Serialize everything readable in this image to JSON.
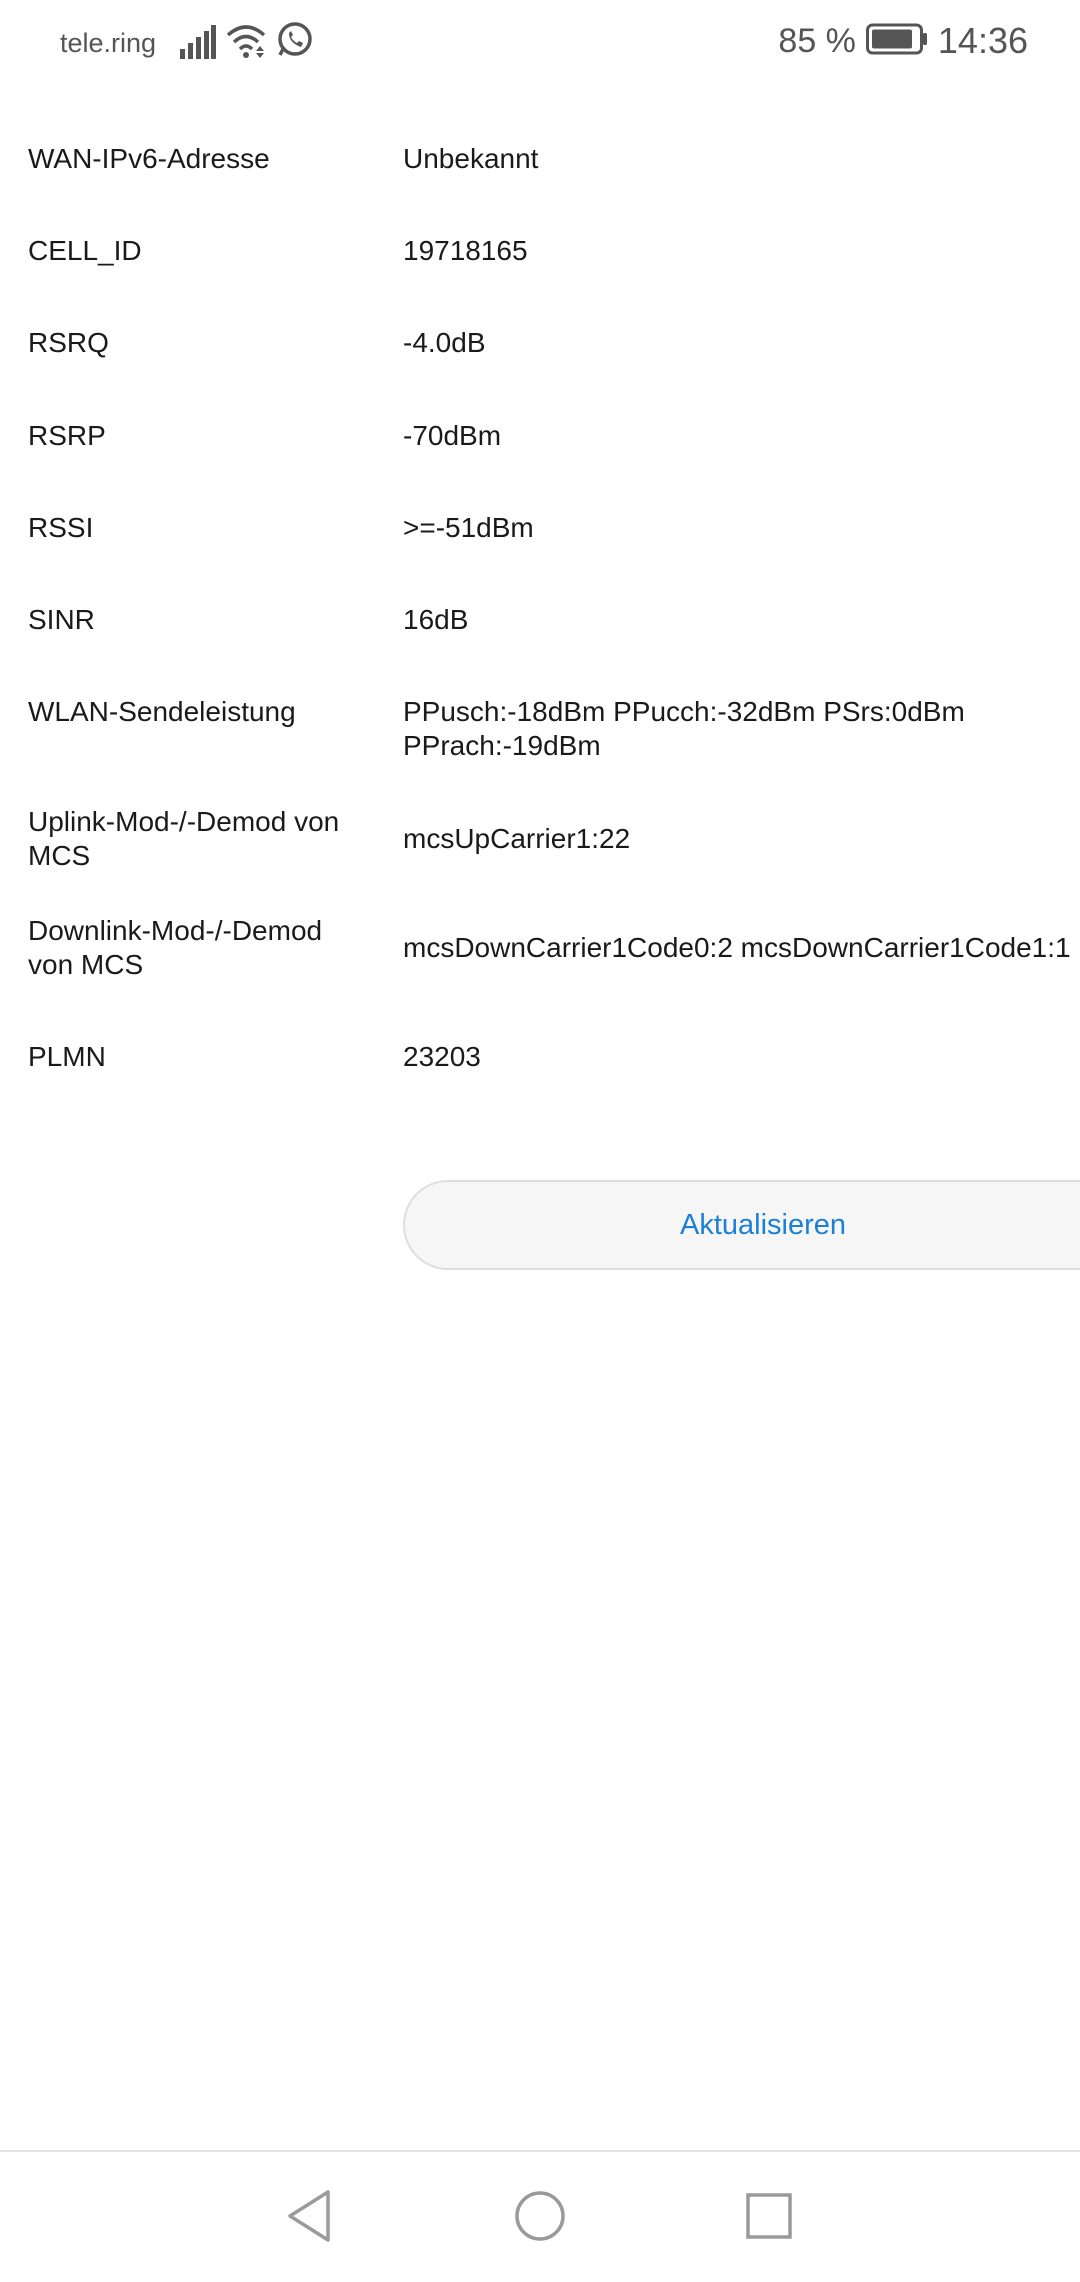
{
  "status_bar": {
    "carrier": "tele.ring",
    "battery_percent": "85 %",
    "time": "14:36",
    "icons": [
      "signal-icon",
      "wifi-icon",
      "whatsapp-icon",
      "battery-icon"
    ]
  },
  "rows": [
    {
      "label": "WAN-IPv6-Adresse",
      "value": "Unbekannt"
    },
    {
      "label": "CELL_ID",
      "value": "19718165"
    },
    {
      "label": "RSRQ",
      "value": "-4.0dB"
    },
    {
      "label": "RSRP",
      "value": "-70dBm"
    },
    {
      "label": "RSSI",
      "value": ">=-51dBm"
    },
    {
      "label": "SINR",
      "value": "16dB"
    },
    {
      "label": "WLAN-Sendeleistung",
      "value": "PPusch:-18dBm PPucch:-32dBm PSrs:0dBm\nPPrach:-19dBm"
    },
    {
      "label": "Uplink-Mod-/-Demod von\nMCS",
      "value": "mcsUpCarrier1:22"
    },
    {
      "label": "Downlink-Mod-/-Demod\nvon MCS",
      "value": "mcsDownCarrier1Code0:2 mcsDownCarrier1Code1:1"
    },
    {
      "label": "PLMN",
      "value": "23203"
    }
  ],
  "refresh_button": {
    "label": "Aktualisieren"
  },
  "nav": {
    "icons": [
      "back-icon",
      "home-icon",
      "recents-icon"
    ]
  },
  "colors": {
    "accent": "#1d7fd6",
    "text": "#1a1a1a",
    "status_text": "#555555"
  }
}
